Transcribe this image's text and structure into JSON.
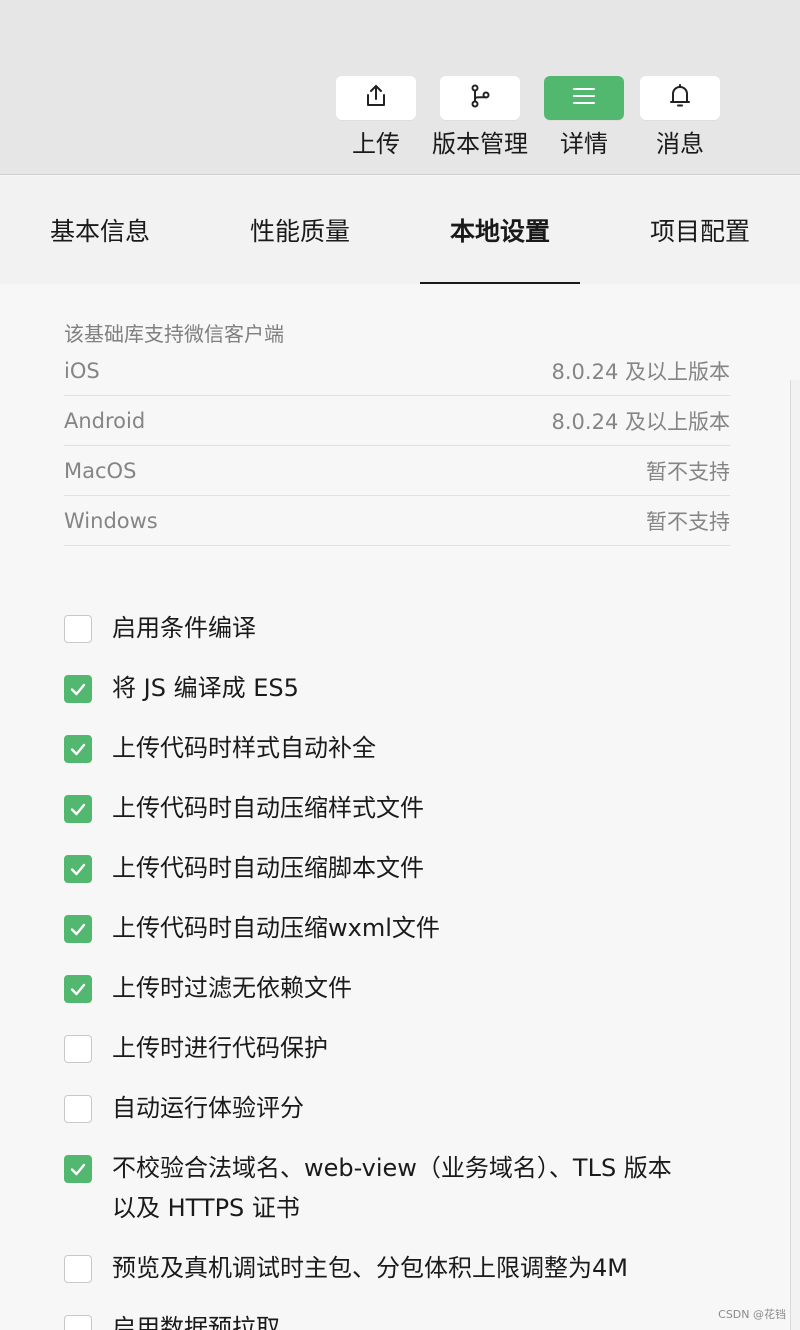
{
  "toolbar": {
    "upload": "上传",
    "version": "版本管理",
    "details": "详情",
    "messages": "消息",
    "accent_color": "#52b86f"
  },
  "tabs": [
    "基本信息",
    "性能质量",
    "本地设置",
    "项目配置"
  ],
  "support": {
    "title": "该基础库支持微信客户端",
    "rows": [
      {
        "platform": "iOS",
        "value": "8.0.24 及以上版本"
      },
      {
        "platform": "Android",
        "value": "8.0.24 及以上版本"
      },
      {
        "platform": "MacOS",
        "value": "暂不支持"
      },
      {
        "platform": "Windows",
        "value": "暂不支持"
      }
    ]
  },
  "options": [
    {
      "label": "启用条件编译",
      "checked": false
    },
    {
      "label": "将 JS 编译成 ES5",
      "checked": true
    },
    {
      "label": "上传代码时样式自动补全",
      "checked": true
    },
    {
      "label": "上传代码时自动压缩样式文件",
      "checked": true
    },
    {
      "label": "上传代码时自动压缩脚本文件",
      "checked": true
    },
    {
      "label": "上传代码时自动压缩wxml文件",
      "checked": true
    },
    {
      "label": "上传时过滤无依赖文件",
      "checked": true
    },
    {
      "label": "上传时进行代码保护",
      "checked": false
    },
    {
      "label": "自动运行体验评分",
      "checked": false
    },
    {
      "label": "不校验合法域名、web-view（业务域名）、TLS 版本以及 HTTPS 证书",
      "checked": true
    },
    {
      "label": "预览及真机调试时主包、分包体积上限调整为4M",
      "checked": false
    },
    {
      "label": "启用数据预拉取",
      "checked": false
    }
  ],
  "watermark": "CSDN @花铛"
}
